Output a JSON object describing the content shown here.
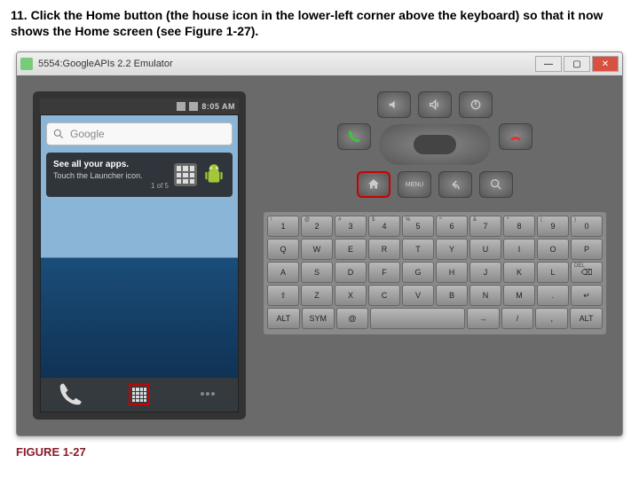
{
  "instruction": "11. Click the Home button (the house icon in the lower-left corner above the keyboard) so that it now shows the Home screen (see Figure 1-27).",
  "titlebar": {
    "title": "5554:GoogleAPIs 2.2 Emulator"
  },
  "statusbar": {
    "clock": "8:05 AM"
  },
  "search": {
    "placeholder": "Google"
  },
  "hint": {
    "title": "See all your apps.",
    "sub": "Touch the Launcher icon.",
    "count": "1 of 5"
  },
  "controls": {
    "menu_label": "MENU"
  },
  "keyboard": {
    "row1": [
      {
        "s": "!",
        "m": "1"
      },
      {
        "s": "@",
        "m": "2"
      },
      {
        "s": "#",
        "m": "3"
      },
      {
        "s": "$",
        "m": "4"
      },
      {
        "s": "%",
        "m": "5"
      },
      {
        "s": "^",
        "m": "6"
      },
      {
        "s": "&",
        "m": "7"
      },
      {
        "s": "*",
        "m": "8"
      },
      {
        "s": "(",
        "m": "9"
      },
      {
        "s": ")",
        "m": "0"
      }
    ],
    "row2": [
      {
        "m": "Q"
      },
      {
        "m": "W"
      },
      {
        "m": "E"
      },
      {
        "m": "R"
      },
      {
        "m": "T"
      },
      {
        "m": "Y"
      },
      {
        "m": "U"
      },
      {
        "m": "I"
      },
      {
        "m": "O"
      },
      {
        "m": "P"
      }
    ],
    "row3": [
      {
        "m": "A"
      },
      {
        "m": "S"
      },
      {
        "m": "D"
      },
      {
        "m": "F"
      },
      {
        "m": "G"
      },
      {
        "m": "H"
      },
      {
        "m": "J"
      },
      {
        "m": "K"
      },
      {
        "m": "L"
      },
      {
        "s": "DEL",
        "m": "⌫"
      }
    ],
    "row4": [
      {
        "m": "⇧"
      },
      {
        "m": "Z"
      },
      {
        "m": "X"
      },
      {
        "m": "C"
      },
      {
        "m": "V"
      },
      {
        "m": "B"
      },
      {
        "m": "N"
      },
      {
        "m": "M"
      },
      {
        "m": "."
      },
      {
        "m": "↵"
      }
    ],
    "row5": [
      {
        "m": "ALT"
      },
      {
        "m": "SYM"
      },
      {
        "m": "@"
      },
      {
        "m": ""
      },
      {
        "m": "→"
      },
      {
        "m": "/"
      },
      {
        "m": ","
      },
      {
        "m": "ALT"
      }
    ]
  },
  "figure_label": "FIGURE 1-27"
}
